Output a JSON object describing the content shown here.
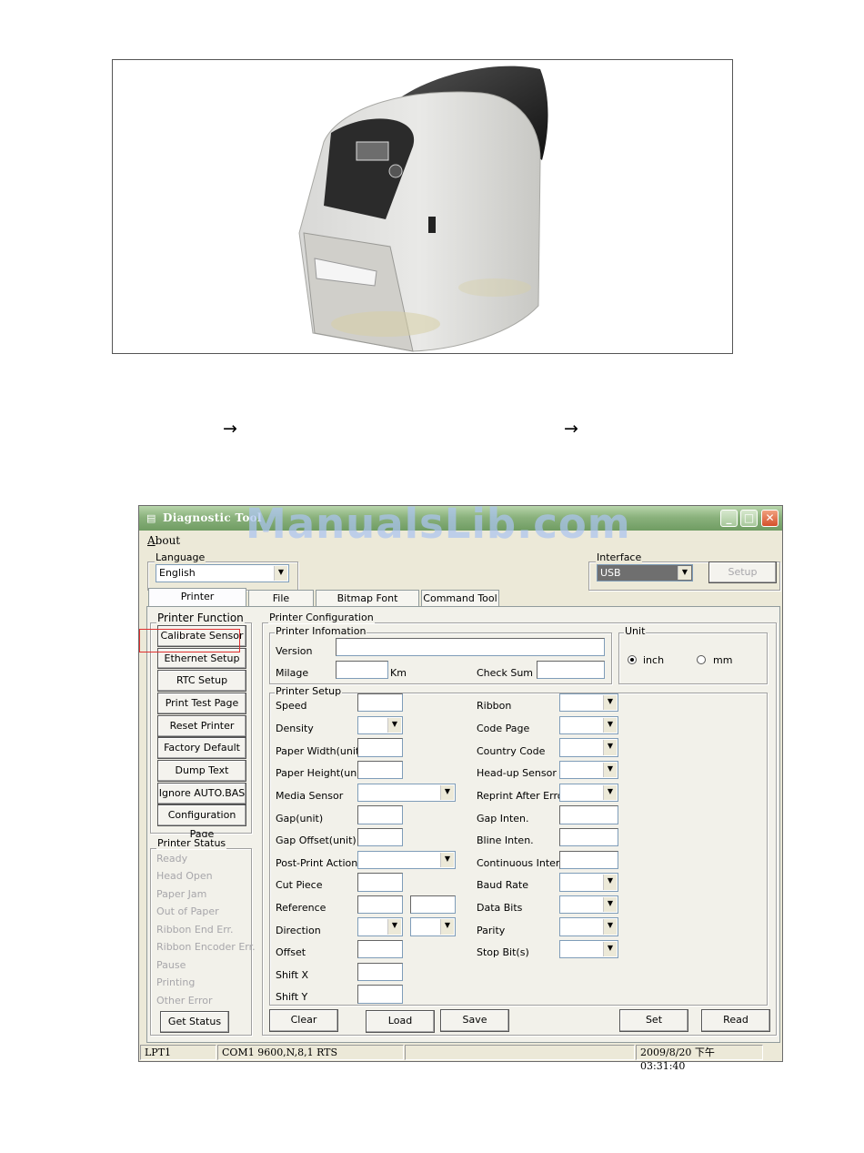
{
  "arrows": [
    "→",
    "→"
  ],
  "window": {
    "title": "Diagnostic Tool",
    "watermark": "ManualsLib.com",
    "menu_about": "About",
    "language": {
      "label": "Language",
      "value": "English"
    },
    "interface": {
      "label": "Interface",
      "value": "USB",
      "setup_button": "Setup"
    },
    "tabs": [
      "Printer Configuration",
      "File Manager",
      "Bitmap Font Manager",
      "Command Tool"
    ],
    "printer_function": {
      "label": "Printer Function",
      "buttons": [
        "Calibrate Sensor",
        "Ethernet Setup",
        "RTC Setup",
        "Print Test Page",
        "Reset Printer",
        "Factory Default",
        "Dump Text",
        "Ignore AUTO.BAS",
        "Configuration Page"
      ]
    },
    "printer_status": {
      "label": "Printer Status",
      "items": [
        "Ready",
        "Head Open",
        "Paper Jam",
        "Out of Paper",
        "Ribbon End Err.",
        "Ribbon Encoder Err.",
        "Pause",
        "Printing",
        "Other Error"
      ],
      "get_status_button": "Get Status"
    },
    "printer_configuration": {
      "label": "Printer Configuration",
      "info": {
        "label": "Printer Infomation",
        "version": "Version",
        "milage": "Milage",
        "km": "Km",
        "check_sum": "Check Sum"
      },
      "unit": {
        "label": "Unit",
        "inch": "inch",
        "mm": "mm",
        "selected": "inch"
      },
      "setup": {
        "label": "Printer Setup",
        "left": [
          "Speed",
          "Density",
          "Paper Width(unit)",
          "Paper Height(unit)",
          "Media Sensor",
          "Gap(unit)",
          "Gap Offset(unit)",
          "Post-Print Action",
          "Cut Piece",
          "Reference",
          "Direction",
          "Offset",
          "Shift X",
          "Shift Y"
        ],
        "right": [
          "Ribbon",
          "Code Page",
          "Country Code",
          "Head-up Sensor",
          "Reprint After Error",
          "Gap Inten.",
          "Bline Inten.",
          "Continuous Inten.",
          "Baud Rate",
          "Data Bits",
          "Parity",
          "Stop Bit(s)"
        ]
      },
      "buttons": {
        "clear": "Clear",
        "load": "Load",
        "save": "Save",
        "set": "Set",
        "read": "Read"
      }
    },
    "statusbar": {
      "port": "LPT1",
      "com": "COM1 9600,N,8,1 RTS",
      "middle": "",
      "datetime": "2009/8/20 下午 03:31:40"
    }
  }
}
